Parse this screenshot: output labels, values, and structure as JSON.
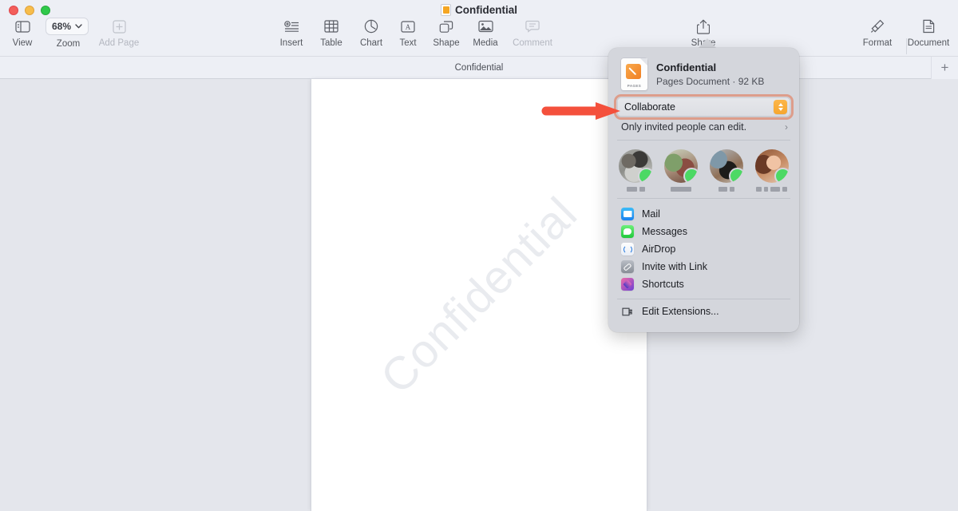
{
  "window": {
    "title": "Confidential",
    "traffic_lights": [
      "close",
      "minimize",
      "maximize"
    ]
  },
  "toolbar": {
    "left_items": [
      {
        "label": "View",
        "icon": "sidebar-icon"
      },
      {
        "label": "Zoom",
        "icon": "zoom-control",
        "value": "68%"
      },
      {
        "label": "Add Page",
        "icon": "plus-box-icon",
        "disabled": true
      }
    ],
    "center_items": [
      {
        "label": "Insert",
        "icon": "insert-icon"
      },
      {
        "label": "Table",
        "icon": "table-icon"
      },
      {
        "label": "Chart",
        "icon": "chart-icon"
      },
      {
        "label": "Text",
        "icon": "text-icon"
      },
      {
        "label": "Shape",
        "icon": "shape-icon"
      },
      {
        "label": "Media",
        "icon": "media-icon"
      },
      {
        "label": "Comment",
        "icon": "comment-icon",
        "disabled": true
      }
    ],
    "share_item": {
      "label": "Share",
      "icon": "share-icon"
    },
    "right_items": [
      {
        "label": "Format",
        "icon": "format-brush-icon"
      },
      {
        "label": "Document",
        "icon": "document-icon"
      }
    ],
    "new_tab_label": "+"
  },
  "tab_bar": {
    "active_tab": "Confidential"
  },
  "document": {
    "watermark": "Confidential"
  },
  "share_popover": {
    "doc_name": "Confidential",
    "doc_meta": "Pages Document · 92 KB",
    "doc_icon_caption": "PAGES",
    "collaborate": {
      "label": "Collaborate",
      "highlighted": true,
      "focus_ring_color": "#e27a58",
      "stepper_color": "#f7a82e"
    },
    "permission": {
      "label": "Only invited people can edit.",
      "chevron": "›"
    },
    "suggested_contacts": [
      {
        "name_redacted": true,
        "badge": "messages-badge",
        "name_bars": [
          13,
          7
        ]
      },
      {
        "name_redacted": true,
        "badge": "messages-badge",
        "name_bars": [
          26
        ]
      },
      {
        "name_redacted": true,
        "badge": "messages-badge",
        "name_bars": [
          11,
          6
        ]
      },
      {
        "name_redacted": true,
        "badge": "messages-badge",
        "name_bars": [
          7,
          5,
          12,
          6
        ]
      }
    ],
    "services": [
      {
        "label": "Mail",
        "icon": "mail-icon"
      },
      {
        "label": "Messages",
        "icon": "messages-icon"
      },
      {
        "label": "AirDrop",
        "icon": "airdrop-icon"
      },
      {
        "label": "Invite with Link",
        "icon": "link-icon"
      },
      {
        "label": "Shortcuts",
        "icon": "shortcuts-icon"
      }
    ],
    "edit_extensions": {
      "label": "Edit Extensions...",
      "icon": "extension-icon"
    }
  },
  "annotation": {
    "arrow": {
      "color": "#f4503c",
      "points_to": "collaborate-button"
    }
  }
}
